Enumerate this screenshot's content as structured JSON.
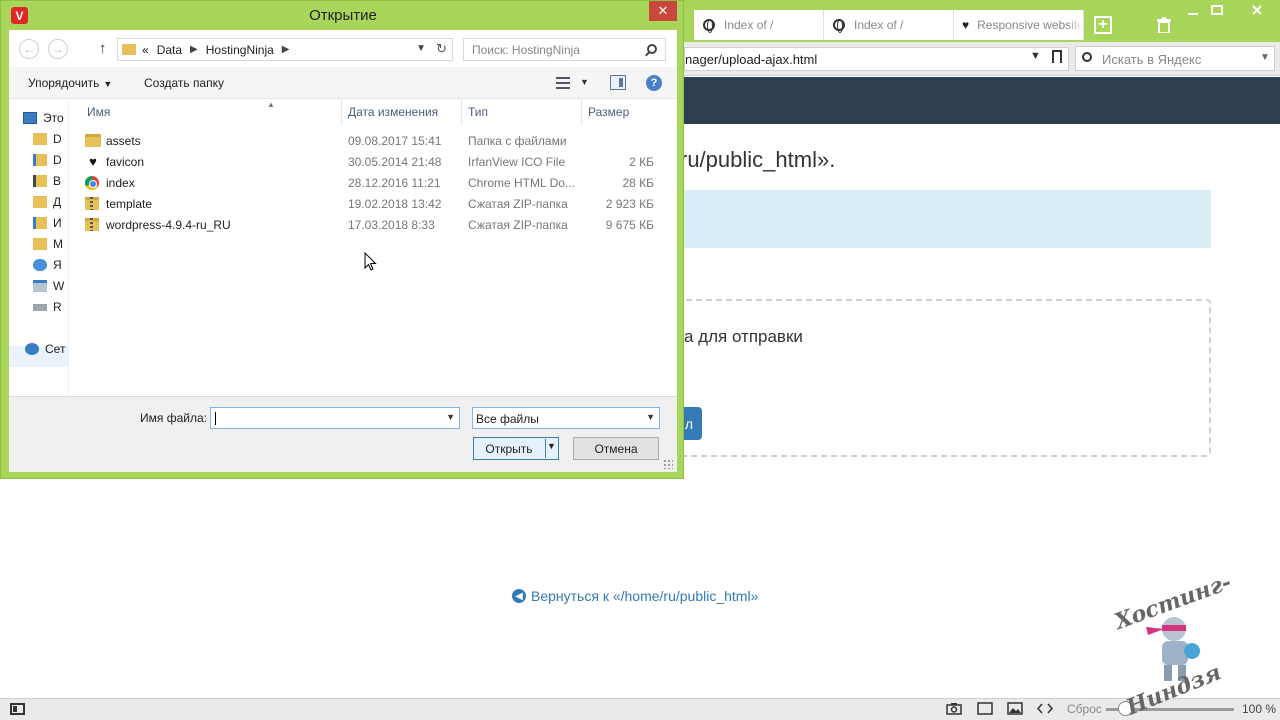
{
  "browser": {
    "tabs": [
      {
        "label": "Index of /",
        "icon": "globe-icon"
      },
      {
        "label": "Index of /",
        "icon": "globe-icon"
      },
      {
        "label": "Responsive website",
        "icon": "heart-icon"
      }
    ],
    "address": "nager/upload-ajax.html",
    "search_placeholder": "Искать в Яндекс",
    "accent_color": "#a7d65b",
    "header_color": "#2c3e50"
  },
  "page": {
    "title": "ru/public_html».",
    "drop_text": "а для отправки",
    "upload_button_fragment": "л",
    "back_link": "Вернуться к «/home/ru/public_html»"
  },
  "statusbar": {
    "reset_label": "Сброс",
    "zoom": "100 %",
    "zoom_level": 0.15
  },
  "mascot": {
    "top_text": "Хостинг-",
    "bottom_text": "Ниндзя"
  },
  "dialog": {
    "app_letter": "V",
    "title": "Открытие",
    "close_label": "✕",
    "breadcrumb": {
      "overflow": "«",
      "items": [
        "Data",
        "HostingNinja"
      ]
    },
    "search_placeholder": "Поиск: HostingNinja",
    "toolbar": {
      "organize_label": "Упорядочить",
      "new_folder_label": "Создать папку"
    },
    "nav_pane": [
      {
        "label": "Это",
        "icon": "computer-icon"
      },
      {
        "label": "D",
        "icon": "folder-icon"
      },
      {
        "label": "D",
        "icon": "folder-icon"
      },
      {
        "label": "В",
        "icon": "folder-icon"
      },
      {
        "label": "Д",
        "icon": "folder-icon"
      },
      {
        "label": "И",
        "icon": "folder-icon"
      },
      {
        "label": "М",
        "icon": "folder-icon"
      },
      {
        "label": "Я",
        "icon": "cloud-icon"
      },
      {
        "label": "W",
        "icon": "windows-drive-icon"
      },
      {
        "label": "R",
        "icon": "drive-icon"
      },
      {
        "label": "Сет",
        "icon": "network-icon"
      }
    ],
    "columns": {
      "name": "Имя",
      "date": "Дата изменения",
      "type": "Тип",
      "size": "Размер"
    },
    "files": [
      {
        "name": "assets",
        "date": "09.08.2017 15:41",
        "type": "Папка с файлами",
        "size": "",
        "icon": "folder-icon"
      },
      {
        "name": "favicon",
        "date": "30.05.2014 21:48",
        "type": "IrfanView ICO File",
        "size": "2 КБ",
        "icon": "heart-icon"
      },
      {
        "name": "index",
        "date": "28.12.2016 11:21",
        "type": "Chrome HTML Do...",
        "size": "28 КБ",
        "icon": "chrome-icon"
      },
      {
        "name": "template",
        "date": "19.02.2018 13:42",
        "type": "Сжатая ZIP-папка",
        "size": "2 923 КБ",
        "icon": "zip-icon"
      },
      {
        "name": "wordpress-4.9.4-ru_RU",
        "date": "17.03.2018 8:33",
        "type": "Сжатая ZIP-папка",
        "size": "9 675 КБ",
        "icon": "zip-icon"
      }
    ],
    "filename_label": "Имя файла:",
    "filename_value": "",
    "filetype_value": "Все файлы",
    "open_label": "Открыть",
    "cancel_label": "Отмена"
  }
}
